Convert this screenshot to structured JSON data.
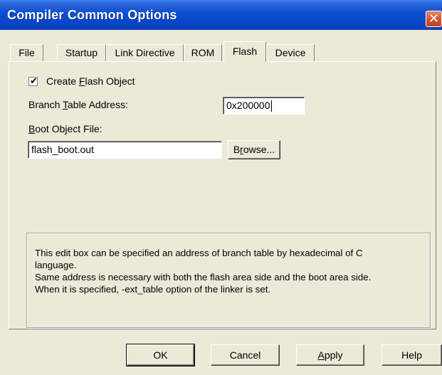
{
  "window": {
    "title": "Compiler Common Options",
    "close_glyph": "✕"
  },
  "tabs": [
    {
      "label": "File",
      "active": false
    },
    {
      "label": "Startup",
      "active": false
    },
    {
      "label": "Link Directive",
      "active": false
    },
    {
      "label": "ROM",
      "active": false
    },
    {
      "label": "Flash",
      "active": true
    },
    {
      "label": "Device",
      "active": false
    }
  ],
  "flash": {
    "create_flash_object": {
      "label_pre": "Create ",
      "label_accel": "F",
      "label_post": "lash Object",
      "checked": true,
      "check_glyph": "✔"
    },
    "branch_table": {
      "label_pre": "Branch ",
      "label_accel": "T",
      "label_post": "able Address:",
      "value": "0x200000"
    },
    "boot_object": {
      "label_pre": "",
      "label_accel": "B",
      "label_post": "oot Object File:",
      "value": "flash_boot.out"
    },
    "browse_button": {
      "label_pre": "B",
      "label_accel": "r",
      "label_post": "owse..."
    },
    "help_lines": [
      "This edit box can be specified an address of branch table by hexadecimal of C",
      "language.",
      "Same address is necessary with both the flash area side and the boot area side.",
      "When it is specified, -ext_table option of the linker is set."
    ]
  },
  "footer": {
    "ok": "OK",
    "cancel": "Cancel",
    "apply_accel": "A",
    "apply_rest": "pply",
    "help": "Help"
  }
}
